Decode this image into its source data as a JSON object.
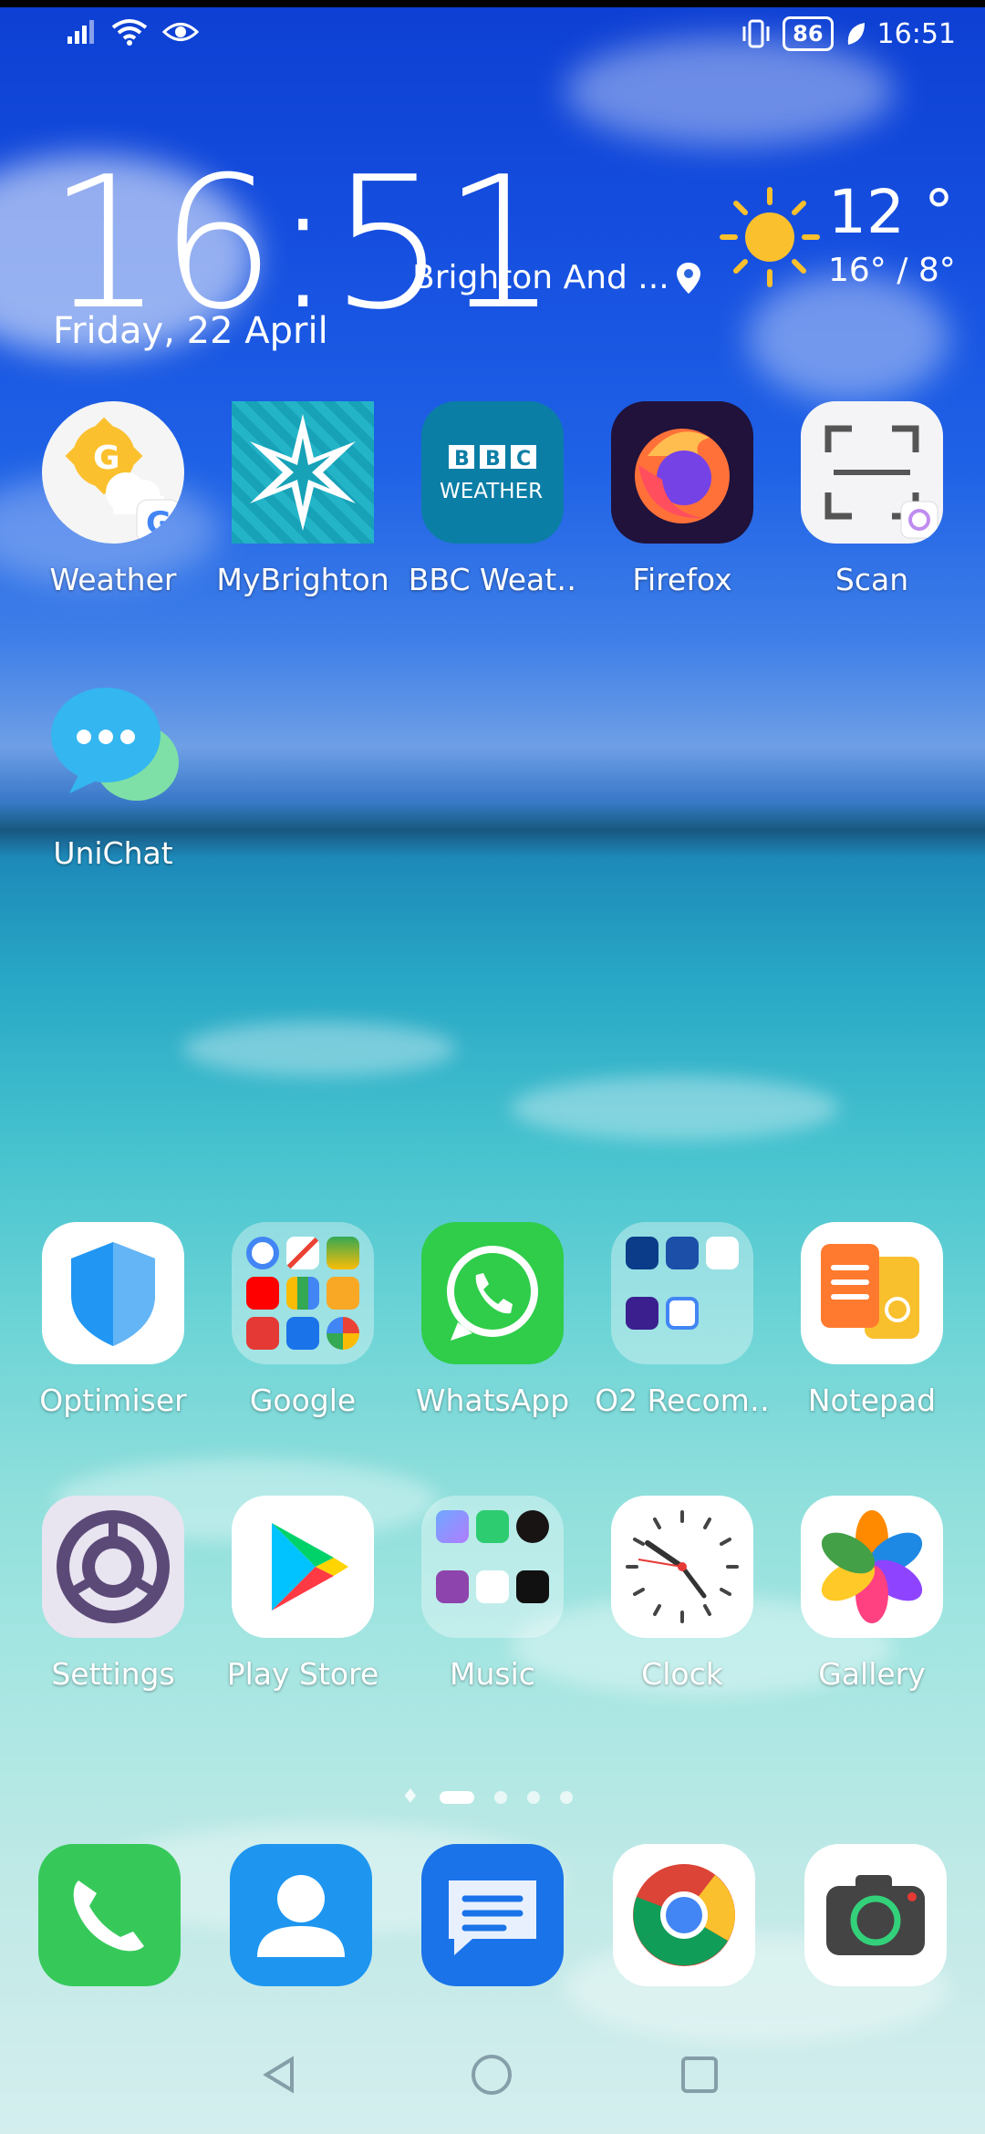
{
  "status_bar": {
    "battery": "86",
    "time": "16:51"
  },
  "widget": {
    "time": "16:51",
    "location": "Brighton And ...",
    "date": "Friday, 22 April",
    "temperature": "12 °",
    "range": "16° / 8°"
  },
  "row1": [
    {
      "label": "Weather",
      "icon": "google-weather-icon"
    },
    {
      "label": "MyBrighton",
      "icon": "mybrighton-star-icon"
    },
    {
      "label": "BBC Weat‥",
      "icon": "bbc-weather-icon"
    },
    {
      "label": "Firefox",
      "icon": "firefox-icon"
    },
    {
      "label": "Scan",
      "icon": "scan-icon"
    }
  ],
  "row2": [
    {
      "label": "UniChat",
      "icon": "chat-bubble-icon"
    }
  ],
  "row3": [
    {
      "label": "Optimiser",
      "icon": "shield-icon"
    },
    {
      "label": "Google",
      "icon": "folder-icon"
    },
    {
      "label": "WhatsApp",
      "icon": "whatsapp-icon"
    },
    {
      "label": "O2 Recom‥",
      "icon": "folder-icon"
    },
    {
      "label": "Notepad",
      "icon": "notepad-icon"
    }
  ],
  "row4": [
    {
      "label": "Settings",
      "icon": "gear-icon"
    },
    {
      "label": "Play Store",
      "icon": "play-store-icon"
    },
    {
      "label": "Music",
      "icon": "folder-icon"
    },
    {
      "label": "Clock",
      "icon": "clock-icon"
    },
    {
      "label": "Gallery",
      "icon": "gallery-flower-icon"
    }
  ],
  "dock": [
    {
      "icon": "phone-icon"
    },
    {
      "icon": "contacts-icon"
    },
    {
      "icon": "messages-icon"
    },
    {
      "icon": "chrome-icon"
    },
    {
      "icon": "camera-icon"
    }
  ],
  "pages": {
    "count": 4,
    "active": 1
  },
  "colors": {
    "whatsapp": "#2fcd4a",
    "phone": "#36c95a",
    "contacts": "#1e96f0",
    "messages": "#1a73e8",
    "bbc": "#0b7ea6",
    "sun": "#fbc02d"
  }
}
